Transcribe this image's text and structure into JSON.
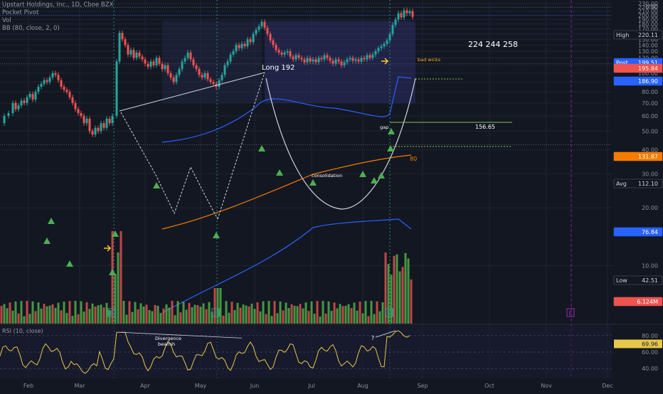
{
  "legend": {
    "symbol": "Upstart Holdings, Inc., 1D, Cboe BZX",
    "indicators": [
      "Pocket Pivot",
      "Vol",
      "BB (80, close, 2, 0)"
    ]
  },
  "price_panel": {
    "currency": "USD",
    "ylim": [
      5,
      232
    ],
    "ticks": [
      10,
      20,
      30,
      40,
      50,
      60,
      70,
      80,
      90,
      100,
      110,
      120,
      130,
      140,
      150,
      160,
      170,
      180,
      190,
      200,
      210,
      220,
      230
    ]
  },
  "price_labels": [
    {
      "label": "High",
      "value": "220.11",
      "color": "#131722",
      "text_color": "#d1d4dc"
    },
    {
      "label": "Post",
      "value": "199.51",
      "color": "#2962ff",
      "text_color": "#ffffff"
    },
    {
      "label": "",
      "value": "195.84",
      "color": "#ef5350",
      "text_color": "#ffffff"
    },
    {
      "label": "",
      "value": "186.90",
      "color": "#2962ff",
      "text_color": "#ffffff"
    },
    {
      "label": "",
      "value": "131.87",
      "color": "#f57c00",
      "text_color": "#ffffff"
    },
    {
      "label": "Avg",
      "value": "112.10",
      "color": "#131722",
      "text_color": "#d1d4dc"
    },
    {
      "label": "",
      "value": "76.84",
      "color": "#2962ff",
      "text_color": "#ffffff"
    },
    {
      "label": "Low",
      "value": "42.51",
      "color": "#131722",
      "text_color": "#d1d4dc"
    },
    {
      "label": "",
      "value": "6.124M",
      "color": "#ef5350",
      "text_color": "#ffffff"
    }
  ],
  "annotations": {
    "long": "Long 192",
    "targets": "224   244   258",
    "bad_wicks": "bad wicks",
    "gap": "gap",
    "level": "156.65",
    "bb_len": "80",
    "consolidation": "consolidation",
    "divergence": "Divergence\nbearish",
    "question": "?"
  },
  "rsi_panel": {
    "label": "RSI (10, close)",
    "current": "69.96",
    "ticks": [
      40,
      60,
      80
    ],
    "ylim": [
      28,
      92
    ]
  },
  "x_axis": {
    "months": [
      "Feb",
      "Mar",
      "Apr",
      "May",
      "Jun",
      "Jul",
      "Aug",
      "Sep",
      "Oct",
      "Nov",
      "Dec"
    ]
  },
  "earnings_marker": "E",
  "colors": {
    "bg": "#131722",
    "up": "#26a69a",
    "down": "#ef5350",
    "bb": "#2962ff",
    "ma": "#f57c00",
    "rsi": "#e6c74a",
    "pivot": "#4caf50",
    "grid": "#1f2433"
  },
  "chart_data": [
    {
      "type": "line",
      "title": "Upstart Holdings, Inc., 1D, Cboe BZX",
      "xlabel": "",
      "ylabel": "",
      "x_categories": [
        "Feb",
        "Mar",
        "Apr",
        "May",
        "Jun",
        "Jul",
        "Aug",
        "Sep",
        "Oct",
        "Nov",
        "Dec"
      ],
      "ylim": [
        5,
        232
      ],
      "log_scale": true,
      "grid": true,
      "series": [
        {
          "name": "",
          "points": [
            [
              0,
              55
            ],
            [
              6,
              60
            ],
            [
              12,
              62
            ],
            [
              18,
              70
            ],
            [
              22,
              65
            ],
            [
              26,
              68
            ],
            [
              30,
              72
            ],
            [
              34,
              70
            ],
            [
              38,
              75
            ],
            [
              42,
              78
            ],
            [
              46,
              73
            ],
            [
              50,
              80
            ],
            [
              54,
              85
            ],
            [
              58,
              88
            ],
            [
              62,
              92
            ],
            [
              66,
              90
            ],
            [
              70,
              95
            ],
            [
              74,
              100
            ],
            [
              78,
              98
            ],
            [
              82,
              92
            ],
            [
              86,
              85
            ],
            [
              90,
              82
            ],
            [
              94,
              80
            ],
            [
              98,
              75
            ],
            [
              102,
              70
            ],
            [
              106,
              65
            ],
            [
              110,
              62
            ],
            [
              114,
              60
            ],
            [
              118,
              55
            ],
            [
              122,
              58
            ],
            [
              126,
              50
            ],
            [
              130,
              48
            ],
            [
              134,
              52
            ],
            [
              138,
              50
            ],
            [
              142,
              55
            ],
            [
              146,
              52
            ],
            [
              150,
              58
            ],
            [
              154,
              55
            ],
            [
              158,
              60
            ],
            [
              164,
              115
            ],
            [
              168,
              162
            ],
            [
              172,
              150
            ],
            [
              176,
              140
            ],
            [
              180,
              125
            ],
            [
              184,
              132
            ],
            [
              188,
              120
            ],
            [
              192,
              128
            ],
            [
              196,
              122
            ],
            [
              200,
              118
            ],
            [
              204,
              112
            ],
            [
              208,
              108
            ],
            [
              212,
              115
            ],
            [
              216,
              110
            ],
            [
              220,
              120
            ],
            [
              224,
              112
            ],
            [
              228,
              105
            ],
            [
              232,
              110
            ],
            [
              236,
              100
            ],
            [
              240,
              95
            ],
            [
              244,
              90
            ],
            [
              248,
              98
            ],
            [
              252,
              105
            ],
            [
              256,
              115
            ],
            [
              260,
              120
            ],
            [
              264,
              128
            ],
            [
              268,
              118
            ],
            [
              272,
              110
            ],
            [
              276,
              105
            ],
            [
              280,
              98
            ],
            [
              284,
              95
            ],
            [
              288,
              100
            ],
            [
              292,
              93
            ],
            [
              296,
              90
            ],
            [
              300,
              88
            ],
            [
              304,
              85
            ],
            [
              308,
              92
            ],
            [
              312,
              98
            ],
            [
              316,
              110
            ],
            [
              320,
              115
            ],
            [
              324,
              125
            ],
            [
              328,
              130
            ],
            [
              332,
              140
            ],
            [
              336,
              135
            ],
            [
              340,
              142
            ],
            [
              344,
              138
            ],
            [
              348,
              150
            ],
            [
              352,
              145
            ],
            [
              356,
              160
            ],
            [
              360,
              168
            ],
            [
              364,
              175
            ],
            [
              368,
              185
            ],
            [
              372,
              172
            ],
            [
              376,
              160
            ],
            [
              380,
              148
            ],
            [
              384,
              140
            ],
            [
              388,
              132
            ],
            [
              392,
              128
            ],
            [
              396,
              125
            ],
            [
              400,
              128
            ],
            [
              404,
              130
            ],
            [
              408,
              122
            ],
            [
              412,
              118
            ],
            [
              416,
              124
            ],
            [
              420,
              120
            ],
            [
              424,
              118
            ],
            [
              428,
              114
            ],
            [
              432,
              120
            ],
            [
              436,
              115
            ],
            [
              440,
              118
            ],
            [
              444,
              114
            ],
            [
              448,
              120
            ],
            [
              452,
              118
            ],
            [
              456,
              124
            ],
            [
              460,
              120
            ],
            [
              464,
              116
            ],
            [
              468,
              112
            ],
            [
              472,
              118
            ],
            [
              476,
              115
            ],
            [
              480,
              110
            ],
            [
              484,
              114
            ],
            [
              488,
              118
            ],
            [
              492,
              120
            ],
            [
              496,
              116
            ],
            [
              500,
              118
            ],
            [
              504,
              115
            ],
            [
              508,
              120
            ],
            [
              512,
              118
            ],
            [
              516,
              124
            ],
            [
              520,
              120
            ],
            [
              524,
              125
            ],
            [
              528,
              130
            ],
            [
              532,
              135
            ],
            [
              536,
              138
            ],
            [
              540,
              142
            ],
            [
              544,
              148
            ],
            [
              548,
              160
            ],
            [
              552,
              178
            ],
            [
              556,
              190
            ],
            [
              560,
              205
            ],
            [
              564,
              195
            ],
            [
              568,
              212
            ],
            [
              572,
              205
            ],
            [
              576,
              210
            ],
            [
              580,
              196
            ]
          ]
        }
      ]
    },
    {
      "type": "bar",
      "title": "Vol",
      "series_name": "",
      "last": "6.124M"
    },
    {
      "type": "line",
      "title": "RSI (10, close)",
      "ylim": [
        28,
        92
      ],
      "ticks": [
        40,
        60,
        80
      ],
      "last": 69.96
    }
  ]
}
